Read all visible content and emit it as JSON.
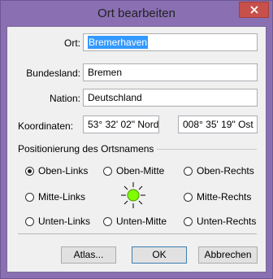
{
  "window": {
    "title": "Ort bearbeiten"
  },
  "fields": {
    "ort": {
      "label": "Ort:",
      "value": "Bremerhaven"
    },
    "bundesland": {
      "label": "Bundesland:",
      "value": "Bremen"
    },
    "nation": {
      "label": "Nation:",
      "value": "Deutschland"
    },
    "koordinaten": {
      "label": "Koordinaten:",
      "lat": "53° 32' 02\" Nord",
      "lon": "008° 35' 19\" Ost"
    }
  },
  "positioning": {
    "title": "Positionierung des Ortsnamens",
    "options": [
      "Oben-Links",
      "Oben-Mitte",
      "Oben-Rechts",
      "Mitte-Links",
      "Mitte-Rechts",
      "Unten-Links",
      "Unten-Mitte",
      "Unten-Rechts"
    ],
    "selected": "Oben-Links"
  },
  "buttons": {
    "atlas": "Atlas...",
    "ok": "OK",
    "cancel": "Abbrechen"
  },
  "colors": {
    "titlebar": "#8a6fb3",
    "close": "#c7504b",
    "selection": "#3399ff",
    "marker": "#7fff00"
  }
}
